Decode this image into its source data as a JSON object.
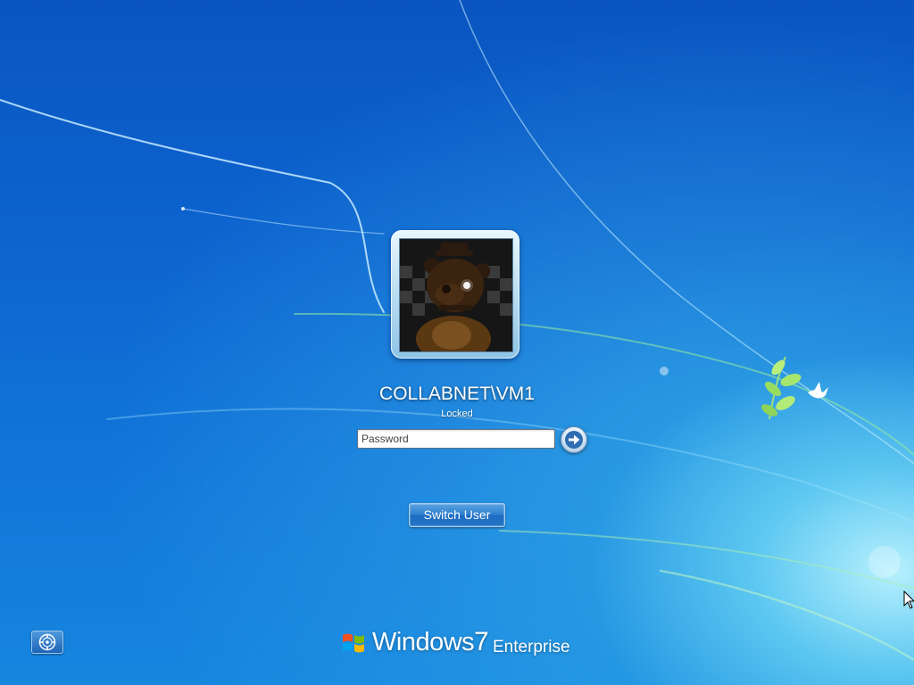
{
  "user": {
    "account_name": "COLLABNET\\VM1",
    "status": "Locked"
  },
  "password": {
    "placeholder": "Password",
    "value": ""
  },
  "buttons": {
    "submit_icon": "arrow-right-icon",
    "switch_user_label": "Switch User",
    "ease_of_access_icon": "ease-of-access-icon"
  },
  "branding": {
    "product": "Windows",
    "version": "7",
    "edition": "Enterprise"
  },
  "colors": {
    "background_deep": "#0a55c0",
    "background_light": "#6fd6f5",
    "accent_button": "#2d7fd0",
    "logo_red": "#f25022",
    "logo_green": "#7fba00",
    "logo_blue": "#00a4ef",
    "logo_yellow": "#ffb900"
  }
}
